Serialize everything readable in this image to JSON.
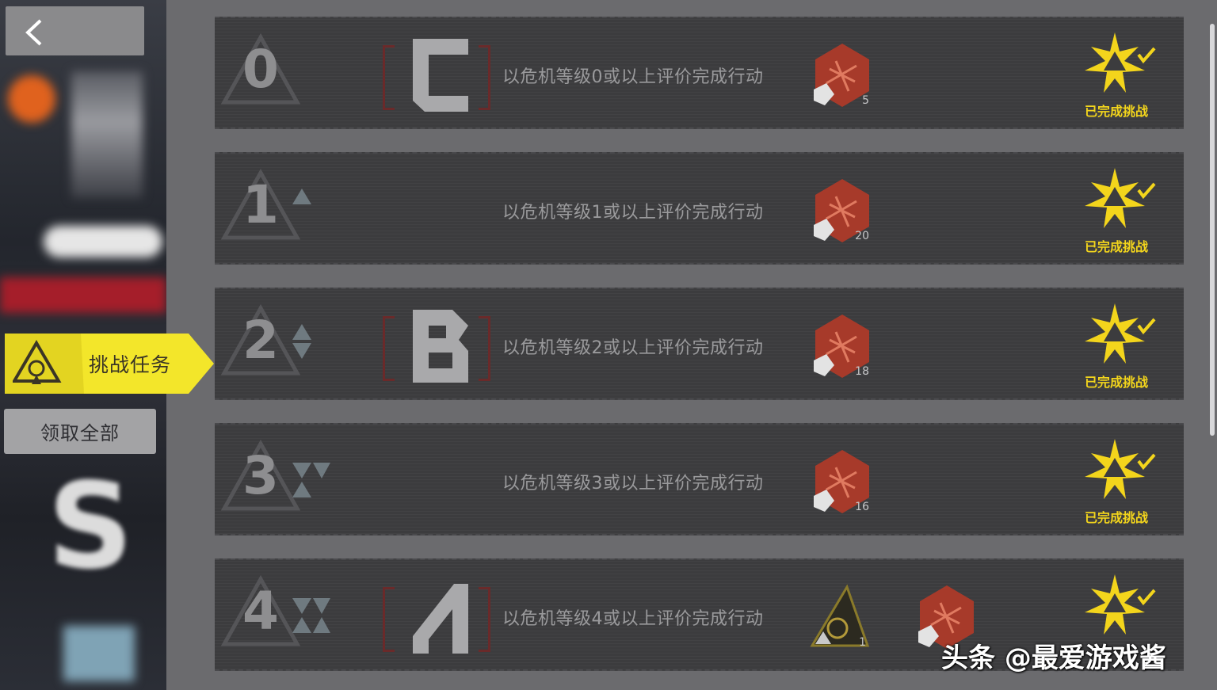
{
  "sidebar": {
    "challenge_tab_label": "挑战任务",
    "claim_all_label": "领取全部"
  },
  "rows": [
    {
      "level": "0",
      "grade": "C",
      "task": "以危机等级0或以上评价完成行动",
      "reward_count": "5",
      "status": "已完成挑战"
    },
    {
      "level": "1",
      "grade": "",
      "task": "以危机等级1或以上评价完成行动",
      "reward_count": "20",
      "status": "已完成挑战"
    },
    {
      "level": "2",
      "grade": "B",
      "task": "以危机等级2或以上评价完成行动",
      "reward_count": "18",
      "status": "已完成挑战"
    },
    {
      "level": "3",
      "grade": "",
      "task": "以危机等级3或以上评价完成行动",
      "reward_count": "16",
      "status": "已完成挑战"
    },
    {
      "level": "4",
      "grade": "A",
      "task": "以危机等级4或以上评价完成行动",
      "reward_count": "1",
      "status": "已完成挑战"
    }
  ],
  "watermark": "头条 @最爱游戏酱",
  "colors": {
    "accent": "#f3d51c",
    "reward": "#b0402e",
    "row_bg": "#3c3c3e"
  }
}
